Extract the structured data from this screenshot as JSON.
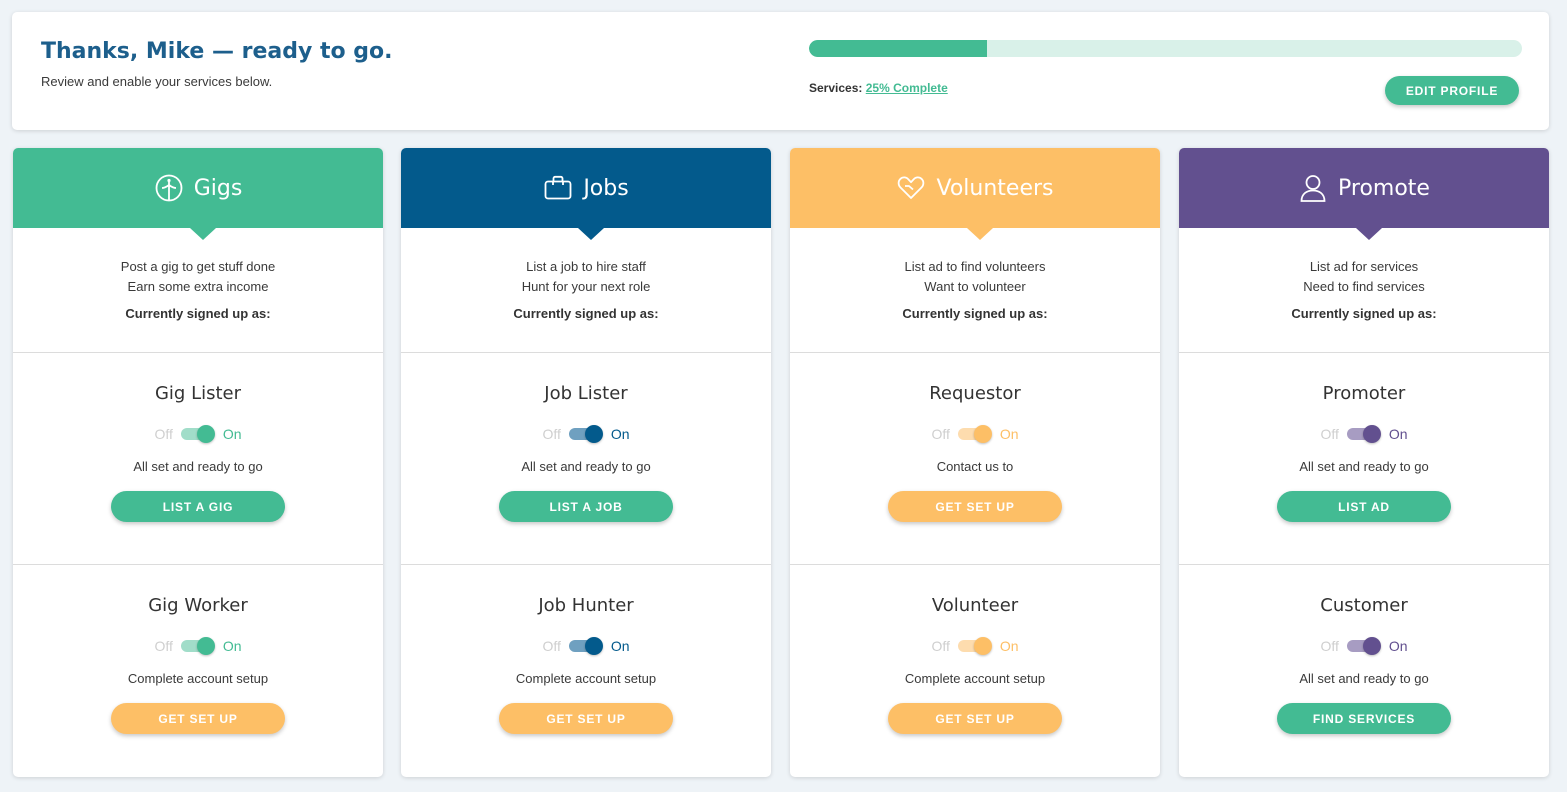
{
  "header": {
    "greeting": "Thanks, Mike — ready to go.",
    "subtitle": "Review and enable your services below.",
    "progress_percent": 25,
    "services_label": "Services:",
    "services_link": "25% Complete",
    "edit_profile": "EDIT PROFILE"
  },
  "colors": {
    "green": "#43bb93",
    "navy": "#035a8c",
    "orange": "#fdbf66",
    "purple": "#62508f"
  },
  "cards": [
    {
      "title": "Gigs",
      "icon": "gig-icon",
      "color": "#43bb93",
      "desc1": "Post a gig to get stuff done",
      "desc2": "Earn some extra income",
      "signed": "Currently signed up as:",
      "roles": [
        {
          "title": "Gig Lister",
          "off": "Off",
          "on": "On",
          "toggle_on": true,
          "status": "All set and ready to go",
          "button": "LIST A GIG",
          "button_color": "green"
        },
        {
          "title": "Gig Worker",
          "off": "Off",
          "on": "On",
          "toggle_on": true,
          "status": "Complete account setup",
          "button": "GET SET UP",
          "button_color": "orange"
        }
      ]
    },
    {
      "title": "Jobs",
      "icon": "briefcase-icon",
      "color": "#035a8c",
      "desc1": "List a job to hire staff",
      "desc2": "Hunt for your next role",
      "signed": "Currently signed up as:",
      "roles": [
        {
          "title": "Job Lister",
          "off": "Off",
          "on": "On",
          "toggle_on": true,
          "status": "All set and ready to go",
          "button": "LIST A JOB",
          "button_color": "green"
        },
        {
          "title": "Job Hunter",
          "off": "Off",
          "on": "On",
          "toggle_on": true,
          "status": "Complete account setup",
          "button": "GET SET UP",
          "button_color": "orange"
        }
      ]
    },
    {
      "title": "Volunteers",
      "icon": "heart-hand-icon",
      "color": "#fdbf66",
      "desc1": "List ad to find volunteers",
      "desc2": "Want to volunteer",
      "signed": "Currently signed up as:",
      "roles": [
        {
          "title": "Requestor",
          "off": "Off",
          "on": "On",
          "toggle_on": true,
          "status": "Contact us to",
          "button": "GET SET UP",
          "button_color": "orange"
        },
        {
          "title": "Volunteer",
          "off": "Off",
          "on": "On",
          "toggle_on": true,
          "status": "Complete account setup",
          "button": "GET SET UP",
          "button_color": "orange"
        }
      ]
    },
    {
      "title": "Promote",
      "icon": "user-icon",
      "color": "#62508f",
      "desc1": "List ad for services",
      "desc2": "Need to find services",
      "signed": "Currently signed up as:",
      "roles": [
        {
          "title": "Promoter",
          "off": "Off",
          "on": "On",
          "toggle_on": true,
          "status": "All set and ready to go",
          "button": "LIST AD",
          "button_color": "green"
        },
        {
          "title": "Customer",
          "off": "Off",
          "on": "On",
          "toggle_on": true,
          "status": "All set and ready to go",
          "button": "FIND SERVICES",
          "button_color": "green"
        }
      ]
    }
  ]
}
